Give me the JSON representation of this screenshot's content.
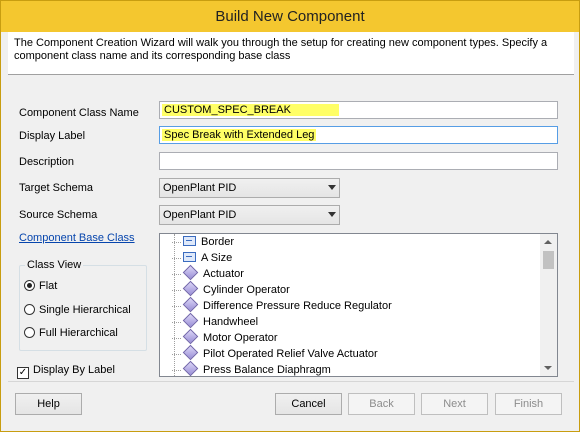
{
  "window": {
    "title": "Build New Component",
    "intro": "The Component Creation Wizard will walk you through the setup for creating new component types.  Specify a component class name and its corresponding base class"
  },
  "form": {
    "class_name_label": "Component Class Name",
    "class_name_value": "CUSTOM_SPEC_BREAK",
    "display_label_label": "Display Label",
    "display_label_value": "Spec Break with Extended Leg",
    "description_label": "Description",
    "description_value": "",
    "target_schema_label": "Target Schema",
    "target_schema_value": "OpenPlant PID",
    "source_schema_label": "Source Schema",
    "source_schema_value": "OpenPlant PID",
    "base_class_link": "Component Base Class"
  },
  "class_view": {
    "title": "Class View",
    "options": [
      {
        "label": "Flat",
        "selected": true
      },
      {
        "label": "Single Hierarchical",
        "selected": false
      },
      {
        "label": "Full Hierarchical",
        "selected": false
      }
    ]
  },
  "display_by_label": {
    "label": "Display By Label",
    "checked": true
  },
  "tree": {
    "items": [
      {
        "label": "Border",
        "icon": "dimension-icon"
      },
      {
        "label": "A Size",
        "icon": "dimension-icon"
      },
      {
        "label": "Actuator",
        "icon": "component-gem-icon"
      },
      {
        "label": "Cylinder Operator",
        "icon": "component-gem-icon"
      },
      {
        "label": "Difference Pressure Reduce Regulator",
        "icon": "component-gem-icon"
      },
      {
        "label": "Handwheel",
        "icon": "component-gem-icon"
      },
      {
        "label": "Motor Operator",
        "icon": "component-gem-icon"
      },
      {
        "label": "Pilot Operated Relief Valve Actuator",
        "icon": "component-gem-icon"
      },
      {
        "label": "Press Balance Diaphragm",
        "icon": "component-gem-icon"
      }
    ]
  },
  "buttons": {
    "help": "Help",
    "cancel": "Cancel",
    "back": "Back",
    "next": "Next",
    "finish": "Finish"
  },
  "colors": {
    "title_bar": "#f4c72f",
    "highlight": "#ffff66",
    "link": "#0645ad"
  }
}
